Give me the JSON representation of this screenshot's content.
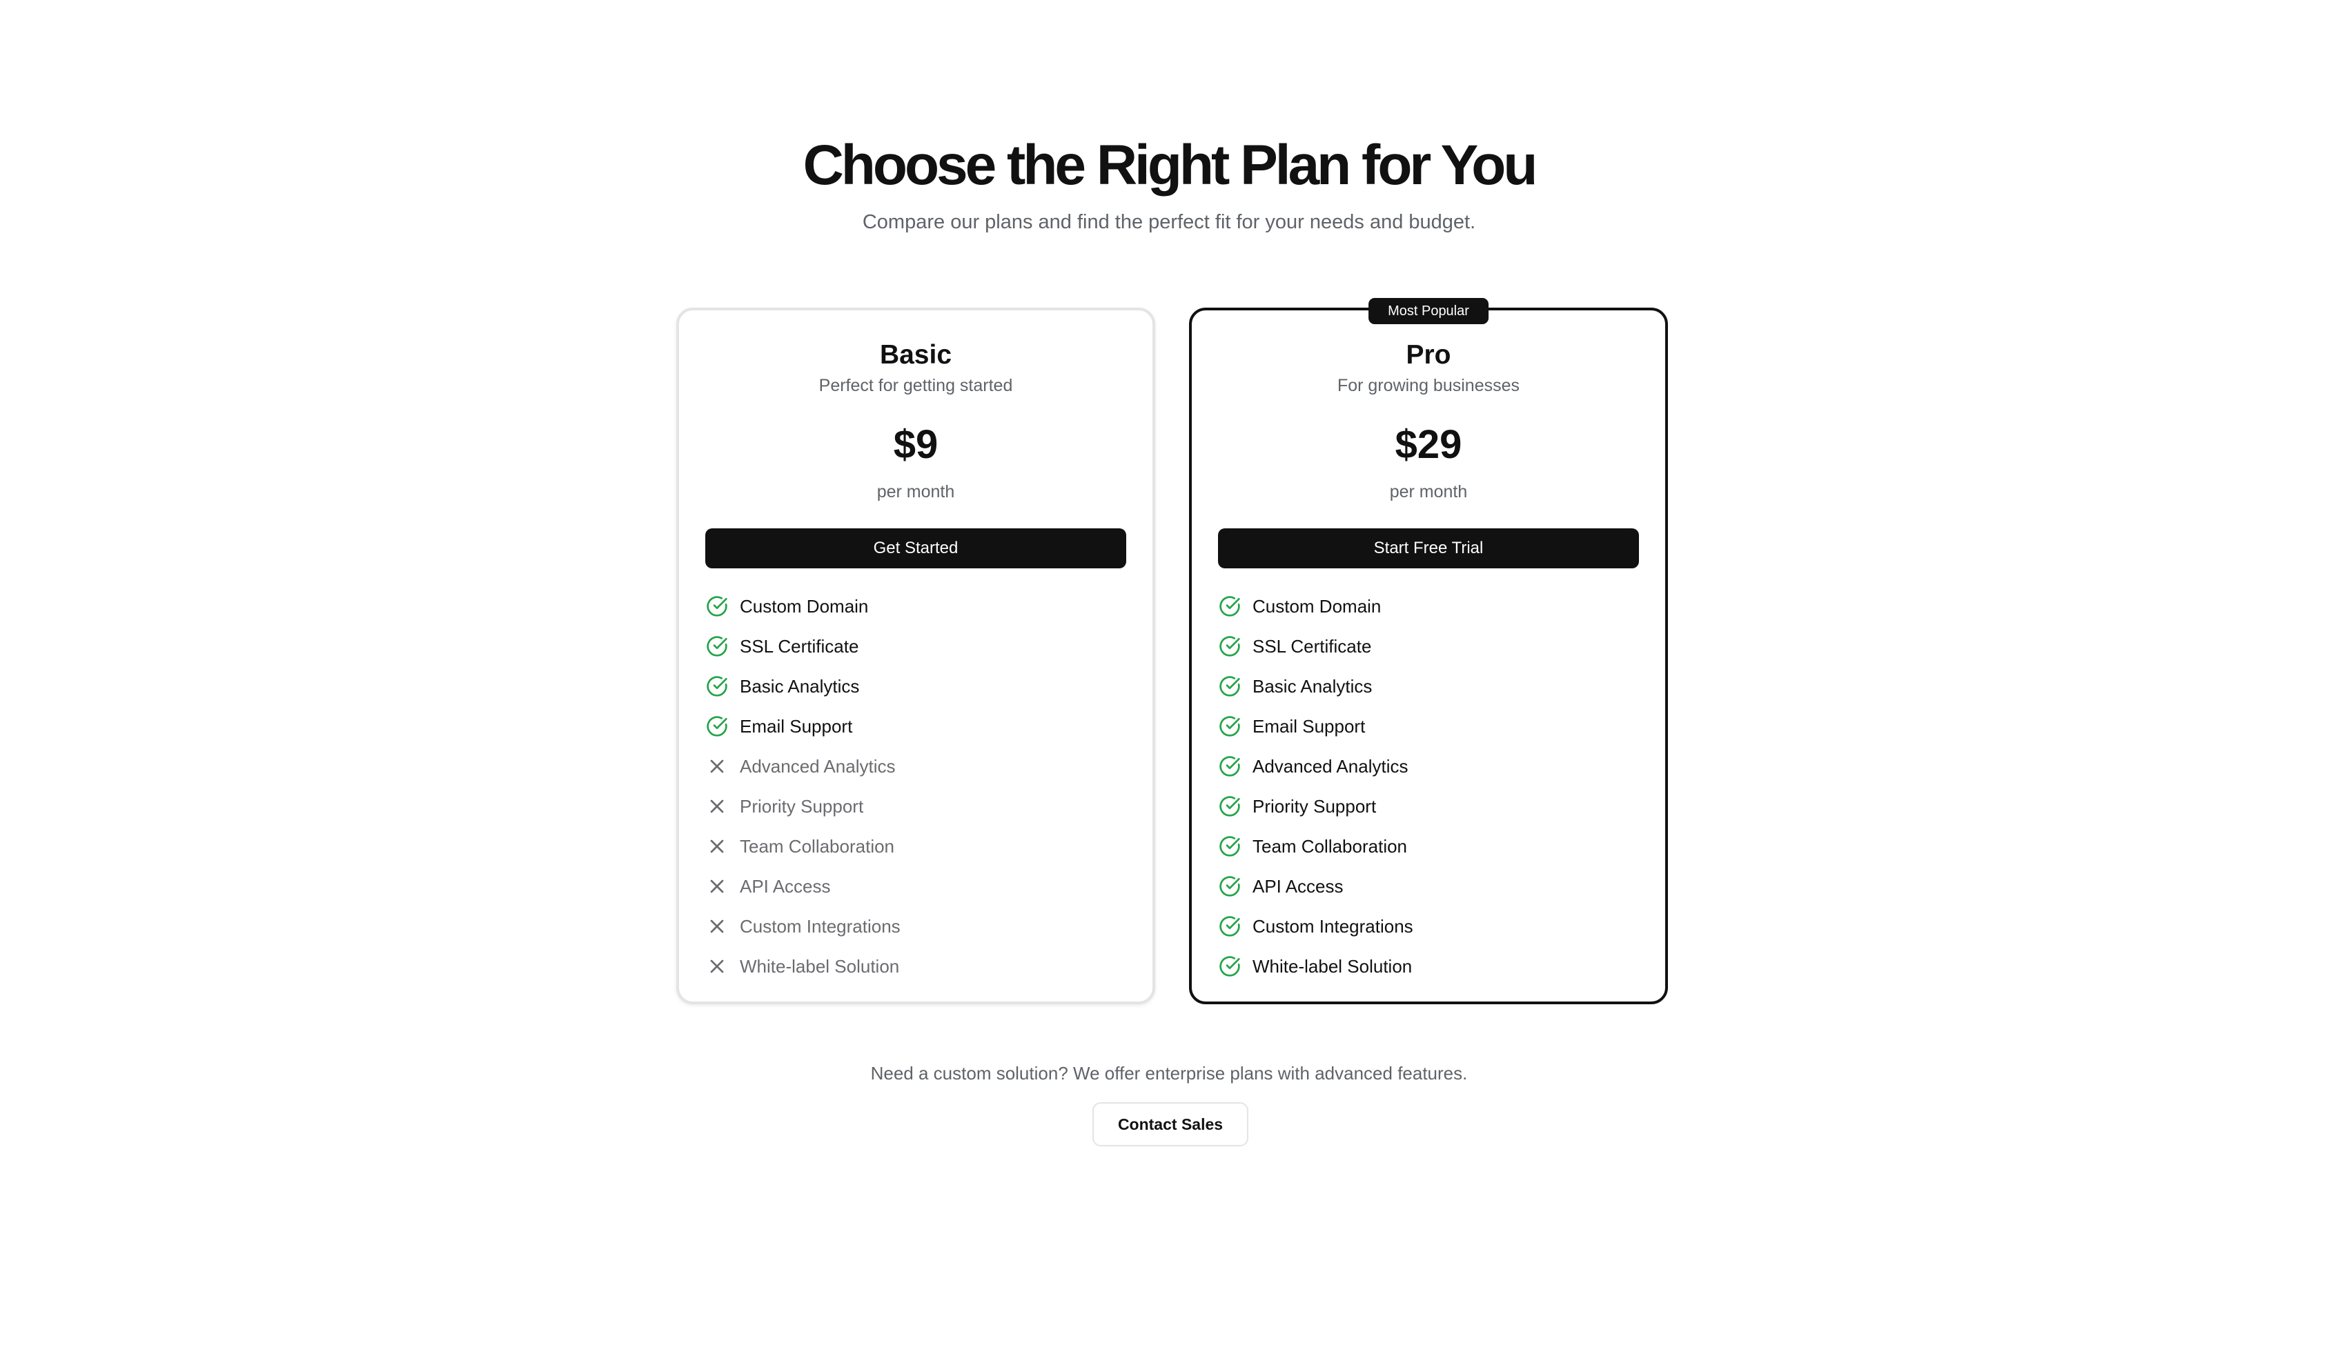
{
  "header": {
    "title": "Choose the Right Plan for You",
    "subtitle": "Compare our plans and find the perfect fit for your needs and budget."
  },
  "colors": {
    "accent": "#111111",
    "included": "#22a447",
    "excluded": "#6b6b70",
    "card_border_basic": "#e4e4e7",
    "muted_text": "#5f6368"
  },
  "plans": [
    {
      "name": "Basic",
      "tagline": "Perfect for getting started",
      "price": "$9",
      "period": "per month",
      "cta_label": "Get Started",
      "features": [
        {
          "label": "Custom Domain",
          "included": true,
          "icon": "check-circle-icon"
        },
        {
          "label": "SSL Certificate",
          "included": true,
          "icon": "check-circle-icon"
        },
        {
          "label": "Basic Analytics",
          "included": true,
          "icon": "check-circle-icon"
        },
        {
          "label": "Email Support",
          "included": true,
          "icon": "check-circle-icon"
        },
        {
          "label": "Advanced Analytics",
          "included": false,
          "icon": "x-icon"
        },
        {
          "label": "Priority Support",
          "included": false,
          "icon": "x-icon"
        },
        {
          "label": "Team Collaboration",
          "included": false,
          "icon": "x-icon"
        },
        {
          "label": "API Access",
          "included": false,
          "icon": "x-icon"
        },
        {
          "label": "Custom Integrations",
          "included": false,
          "icon": "x-icon"
        },
        {
          "label": "White-label Solution",
          "included": false,
          "icon": "x-icon"
        }
      ]
    },
    {
      "name": "Pro",
      "badge": "Most Popular",
      "tagline": "For growing businesses",
      "price": "$29",
      "period": "per month",
      "cta_label": "Start Free Trial",
      "features": [
        {
          "label": "Custom Domain",
          "included": true,
          "icon": "check-circle-icon"
        },
        {
          "label": "SSL Certificate",
          "included": true,
          "icon": "check-circle-icon"
        },
        {
          "label": "Basic Analytics",
          "included": true,
          "icon": "check-circle-icon"
        },
        {
          "label": "Email Support",
          "included": true,
          "icon": "check-circle-icon"
        },
        {
          "label": "Advanced Analytics",
          "included": true,
          "icon": "check-circle-icon"
        },
        {
          "label": "Priority Support",
          "included": true,
          "icon": "check-circle-icon"
        },
        {
          "label": "Team Collaboration",
          "included": true,
          "icon": "check-circle-icon"
        },
        {
          "label": "API Access",
          "included": true,
          "icon": "check-circle-icon"
        },
        {
          "label": "Custom Integrations",
          "included": true,
          "icon": "check-circle-icon"
        },
        {
          "label": "White-label Solution",
          "included": true,
          "icon": "check-circle-icon"
        }
      ]
    }
  ],
  "footer": {
    "text": "Need a custom solution? We offer enterprise plans with advanced features.",
    "contact_label": "Contact Sales"
  }
}
